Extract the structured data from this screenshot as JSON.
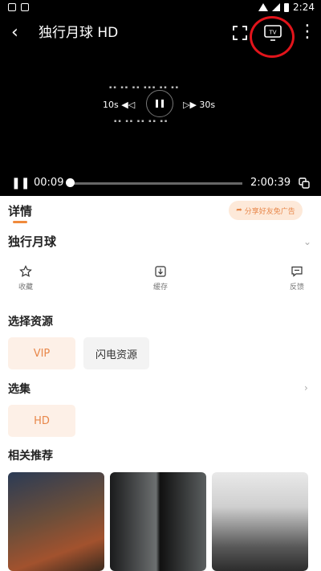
{
  "status_bar": {
    "time": "2:24"
  },
  "player": {
    "title": "独行月球 HD",
    "skip_back": "10s",
    "skip_forward": "30s",
    "current_time": "00:09",
    "duration": "2:00:39",
    "progress": 0.0012,
    "icons": [
      "back-arrow-icon",
      "fullscreen-icon",
      "tv-cast-icon",
      "more-vertical-icon",
      "pause-icon",
      "copy-icon"
    ],
    "highlight_color": "#e2141b"
  },
  "tabs": {
    "details": "详情",
    "share": "分享好友免广告"
  },
  "movie": {
    "title": "独行月球"
  },
  "actions": [
    {
      "label": "收藏",
      "icon": "star-icon"
    },
    {
      "label": "缓存",
      "icon": "download-icon"
    },
    {
      "label": "反馈",
      "icon": "feedback-icon"
    }
  ],
  "sources": {
    "heading": "选择资源",
    "items": [
      "VIP",
      "闪电资源"
    ]
  },
  "episodes": {
    "heading": "选集",
    "items": [
      "HD"
    ]
  },
  "related": {
    "heading": "相关推荐"
  },
  "theme": {
    "accent": "#f08a3c",
    "chip_selected_bg": "#fdf0e7"
  }
}
